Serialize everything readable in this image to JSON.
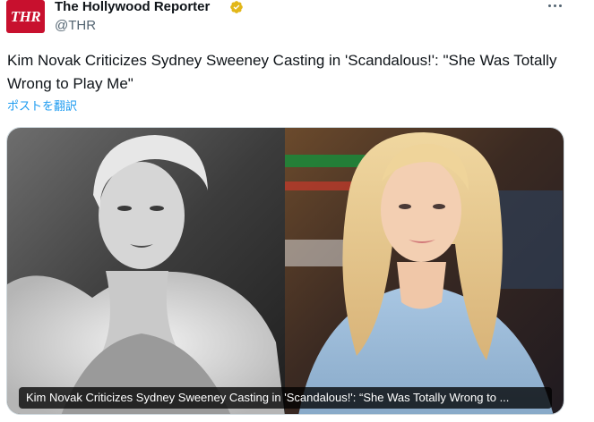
{
  "post": {
    "author": {
      "avatar_text": "THR",
      "name": "The Hollywood Reporter",
      "handle": "@THR",
      "verified_icon": "verified-badge-icon",
      "verified_color": "#e2b719"
    },
    "more_icon": "more-horizontal-icon",
    "text": "Kim Novak Criticizes Sydney Sweeney Casting in 'Scandalous!': \"She Was Totally Wrong to Play Me\"",
    "translate_label": "ポストを翻訳",
    "media": {
      "caption": "Kim Novak Criticizes Sydney Sweeney Casting in 'Scandalous!': “She Was Totally Wrong to ..."
    }
  },
  "colors": {
    "link": "#1d9bf0",
    "secondary_text": "#536471",
    "brand_red": "#c8102e"
  }
}
